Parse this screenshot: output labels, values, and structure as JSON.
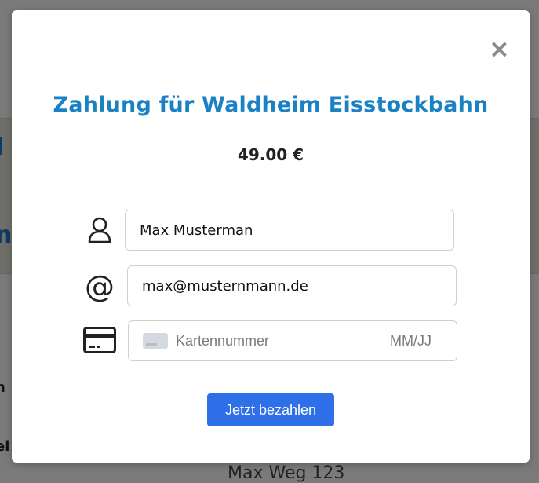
{
  "background": {
    "fragment_top": "I",
    "fragment_mid": "n",
    "fragment_row1": "n",
    "fragment_row2": "el",
    "fragment_address": "Max Weg 123"
  },
  "modal": {
    "title": "Zahlung für Waldheim Eisstockbahn",
    "amount": "49.00 €",
    "close_label": "×",
    "fields": {
      "name": {
        "value": "Max Musterman",
        "icon": "user-icon"
      },
      "email": {
        "value": "max@musternmann.de",
        "icon": "at-icon"
      },
      "card": {
        "placeholder": "Kartennummer",
        "expiry_placeholder": "MM/JJ",
        "icon": "credit-card-icon"
      }
    },
    "pay_button": "Jetzt bezahlen"
  },
  "colors": {
    "title": "#1a82c4",
    "button": "#2f6fe8",
    "overlay": "#7a7a7a"
  }
}
